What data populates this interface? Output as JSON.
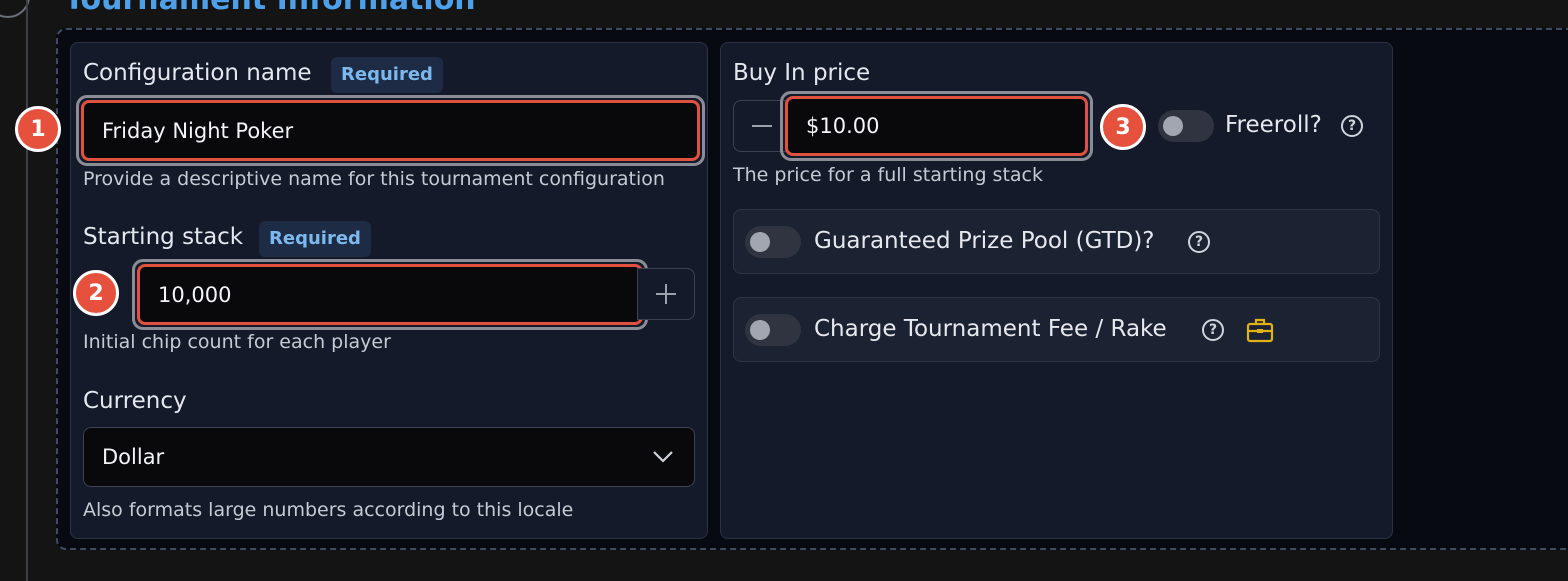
{
  "section": {
    "title": "Tournament Information",
    "next_title": ""
  },
  "config_name": {
    "label": "Configuration name",
    "badge": "Required",
    "value": "Friday Night Poker",
    "help": "Provide a descriptive name for this tournament configuration",
    "marker": "1"
  },
  "starting_stack": {
    "label": "Starting stack",
    "badge": "Required",
    "value": "10,000",
    "help": "Initial chip count for each player",
    "marker": "2",
    "plus_icon": "plus-icon"
  },
  "currency": {
    "label": "Currency",
    "selected": "Dollar",
    "help": "Also formats large numbers according to this locale",
    "chevron_icon": "chevron-down-icon"
  },
  "buy_in": {
    "label": "Buy In price",
    "value": "$10.00",
    "help": "The price for a full starting stack",
    "marker": "3",
    "minus_icon": "minus-icon"
  },
  "freeroll": {
    "label": "Freeroll?",
    "enabled": false
  },
  "gtd": {
    "label": "Guaranteed Prize Pool (GTD)?",
    "enabled": false
  },
  "rake": {
    "label": "Charge Tournament Fee / Rake",
    "enabled": false,
    "accent_icon": "briefcase-icon",
    "accent_color": "#e0b11a"
  },
  "colors": {
    "accent": "#4ea0e8",
    "marker": "#e5513d",
    "focus_border": "#e0513f"
  }
}
